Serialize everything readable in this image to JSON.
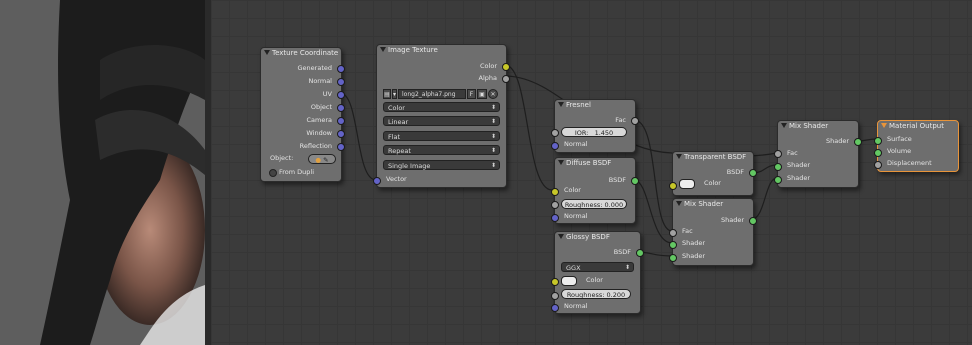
{
  "viewport": {
    "alt": "render preview"
  },
  "nodes": {
    "texcoord": {
      "title": "Texture Coordinate",
      "outputs": [
        "Generated",
        "Normal",
        "UV",
        "Object",
        "Camera",
        "Window",
        "Reflection"
      ],
      "object_label": "Object:",
      "from_dupli": "From Dupli"
    },
    "imgtex": {
      "title": "Image Texture",
      "outputs": [
        "Color",
        "Alpha"
      ],
      "image_name": "long2_alpha7.png",
      "image_user_count": "F",
      "color_mode": "Color",
      "interpolation": "Linear",
      "projection": "Flat",
      "extension": "Repeat",
      "source": "Single Image",
      "input": "Vector"
    },
    "fresnel": {
      "title": "Fresnel",
      "output": "Fac",
      "ior_label": "IOR:",
      "ior_value": "1.450",
      "input_normal": "Normal"
    },
    "diffuse": {
      "title": "Diffuse BSDF",
      "output": "BSDF",
      "input_color": "Color",
      "roughness": "Roughness: 0.000",
      "input_normal": "Normal"
    },
    "glossy": {
      "title": "Glossy BSDF",
      "output": "BSDF",
      "distribution": "GGX",
      "input_color": "Color",
      "roughness": "Roughness: 0.200",
      "input_normal": "Normal"
    },
    "transparent": {
      "title": "Transparent BSDF",
      "output": "BSDF",
      "input_color": "Color"
    },
    "mix1": {
      "title": "Mix Shader",
      "output": "Shader",
      "input_fac": "Fac",
      "input_shader1": "Shader",
      "input_shader2": "Shader"
    },
    "mix2": {
      "title": "Mix Shader",
      "output": "Shader",
      "input_fac": "Fac",
      "input_shader1": "Shader",
      "input_shader2": "Shader"
    },
    "matout": {
      "title": "Material Output",
      "inputs": [
        "Surface",
        "Volume",
        "Displacement"
      ]
    }
  },
  "colors": {
    "socket_vector": "#6363c7",
    "socket_color": "#c7c729",
    "socket_value": "#a1a1a1",
    "socket_shader": "#63c763",
    "active_outline": "#e8943a"
  }
}
